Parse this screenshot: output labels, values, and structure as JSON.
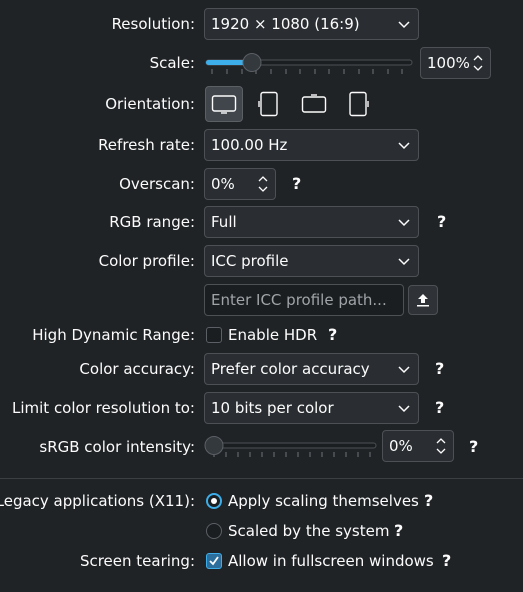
{
  "resolution": {
    "label": "Resolution:",
    "value": "1920 × 1080 (16:9)"
  },
  "scale": {
    "label": "Scale:",
    "value": "100%",
    "level": 0.22
  },
  "orientation": {
    "label": "Orientation:",
    "icons": [
      "landscape-icon",
      "portrait-icon",
      "landscape-flipped-icon",
      "portrait-flipped-icon"
    ]
  },
  "refresh_rate": {
    "label": "Refresh rate:",
    "value": "100.00 Hz"
  },
  "overscan": {
    "label": "Overscan:",
    "value": "0%",
    "help": "?"
  },
  "rgb_range": {
    "label": "RGB range:",
    "value": "Full",
    "help": "?"
  },
  "color_profile": {
    "label": "Color profile:",
    "value": "ICC profile",
    "path_placeholder": "Enter ICC profile path..."
  },
  "hdr": {
    "label": "High Dynamic Range:",
    "option": "Enable HDR",
    "checked": false,
    "help": "?"
  },
  "color_accuracy": {
    "label": "Color accuracy:",
    "value": "Prefer color accuracy",
    "help": "?"
  },
  "color_resolution": {
    "label": "Limit color resolution to:",
    "value": "10 bits per color",
    "help": "?"
  },
  "srgb": {
    "label": "sRGB color intensity:",
    "value": "0%",
    "level": 0,
    "help": "?"
  },
  "legacy": {
    "label": "Legacy applications (X11):",
    "options": [
      {
        "text": "Apply scaling themselves",
        "selected": true,
        "help": "?"
      },
      {
        "text": "Scaled by the system",
        "selected": false,
        "help": "?"
      }
    ]
  },
  "tearing": {
    "label": "Screen tearing:",
    "option": "Allow in fullscreen windows",
    "checked": true,
    "help": "?"
  },
  "colors": {
    "accent": "#3daee9",
    "background": "#202326"
  }
}
